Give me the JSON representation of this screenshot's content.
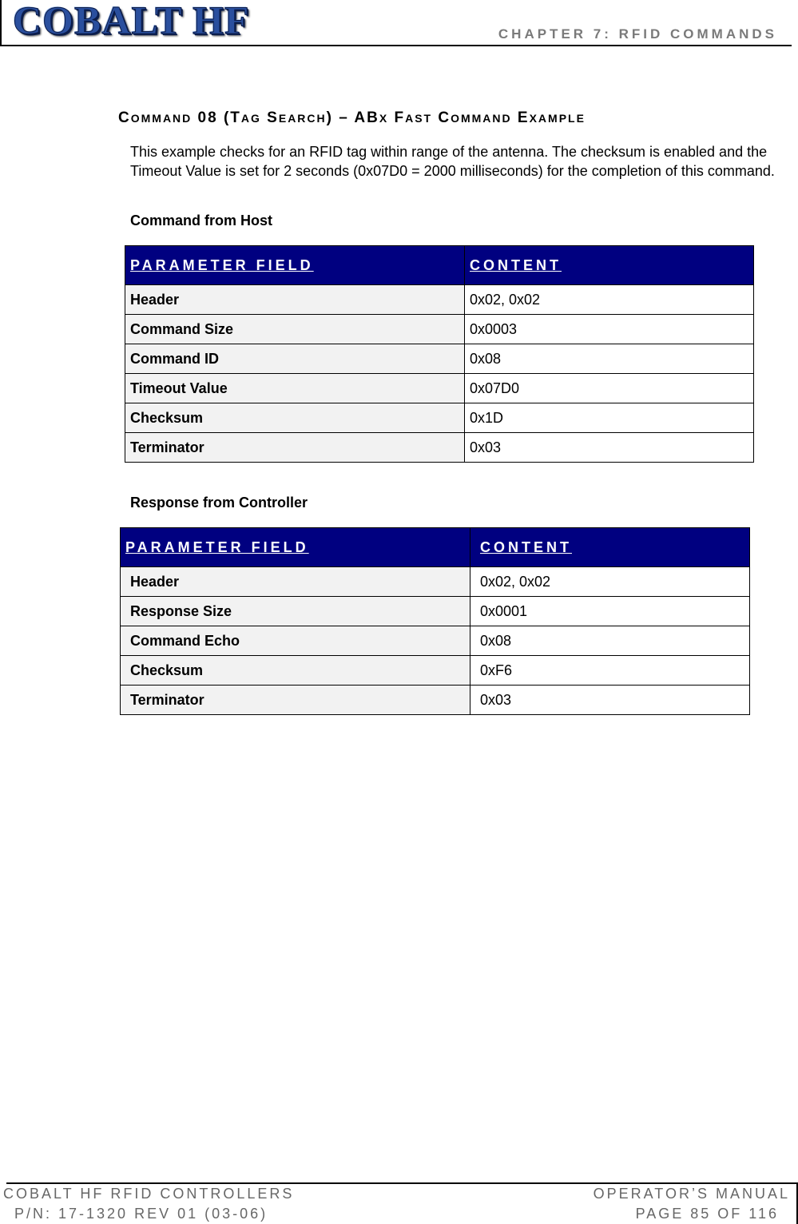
{
  "header": {
    "logo_text": "COBALT HF",
    "chapter": "CHAPTER 7: RFID COMMANDS"
  },
  "section": {
    "title_parts": [
      "C",
      "OMMAND",
      " 08 (T",
      "AG",
      " S",
      "EARCH",
      ") – AB",
      "X",
      " F",
      "AST",
      " C",
      "OMMAND",
      " E",
      "XAMPLE"
    ],
    "title": "Command 08 (Tag Search) – ABx Fast Command Example",
    "paragraph": "This example checks for an RFID tag within range of the antenna. The checksum is enabled and the Timeout Value is set for 2 seconds (0x07D0 = 2000 milliseconds) for the completion of this command."
  },
  "command_table": {
    "subhead": "Command from Host",
    "headers": [
      "PARAMETER FIELD",
      "CONTENT"
    ],
    "rows": [
      {
        "field": "Header",
        "content": "0x02, 0x02"
      },
      {
        "field": "Command Size",
        "content": "0x0003"
      },
      {
        "field": "Command ID",
        "content": "0x08"
      },
      {
        "field": "Timeout Value",
        "content": "0x07D0"
      },
      {
        "field": "Checksum",
        "content": "0x1D"
      },
      {
        "field": "Terminator",
        "content": "0x03"
      }
    ]
  },
  "response_table": {
    "subhead": "Response from Controller",
    "headers": [
      "PARAMETER FIELD",
      "CONTENT"
    ],
    "rows": [
      {
        "field": "Header",
        "content": "0x02, 0x02"
      },
      {
        "field": "Response Size",
        "content": "0x0001"
      },
      {
        "field": "Command Echo",
        "content": "0x08"
      },
      {
        "field": "Checksum",
        "content": "0xF6"
      },
      {
        "field": "Terminator",
        "content": "0x03"
      }
    ]
  },
  "footer": {
    "left_line1": "COBALT HF RFID CONTROLLERS",
    "left_line2": "P/N: 17-1320 REV 01 (03-06)",
    "right_line1": "OPERATOR’S MANUAL",
    "right_line2": "PAGE 85 OF 116"
  }
}
